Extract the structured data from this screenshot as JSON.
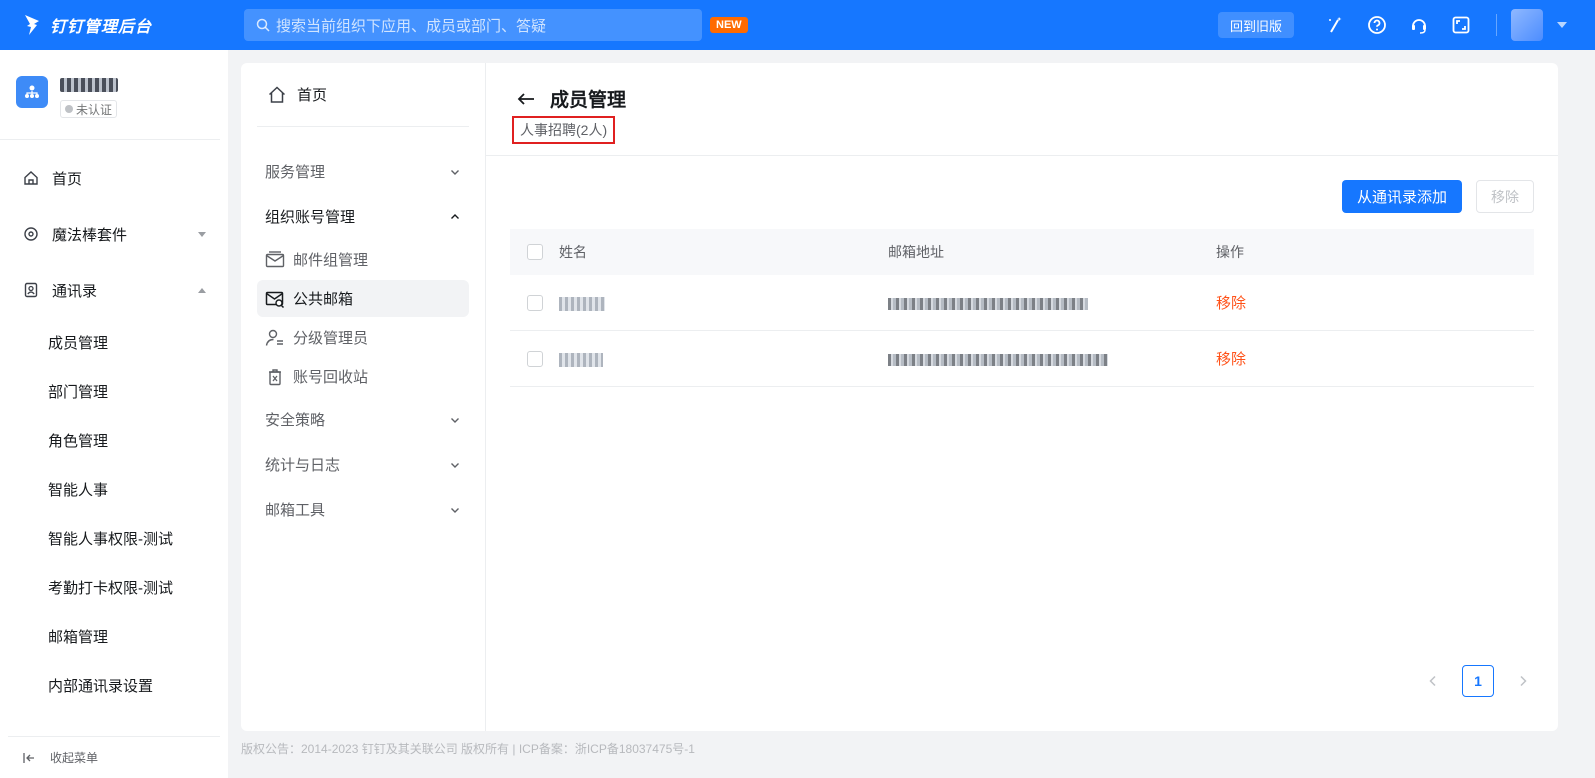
{
  "topbar": {
    "brand_title": "钉钉管理后台",
    "search_placeholder": "搜索当前组织下应用、成员或部门、答疑",
    "new_badge": "NEW",
    "old_version_label": "回到旧版"
  },
  "sidebar": {
    "org_cert": "未认证",
    "items": [
      {
        "label": "首页"
      },
      {
        "label": "魔法棒套件"
      },
      {
        "label": "通讯录"
      }
    ],
    "sub_items": [
      {
        "label": "成员管理"
      },
      {
        "label": "部门管理"
      },
      {
        "label": "角色管理"
      },
      {
        "label": "智能人事"
      },
      {
        "label": "智能人事权限-测试"
      },
      {
        "label": "考勤打卡权限-测试"
      },
      {
        "label": "邮箱管理"
      },
      {
        "label": "内部通讯录设置"
      }
    ],
    "collapse_label": "收起菜单"
  },
  "inner_nav": {
    "home": "首页",
    "groups": [
      {
        "label": "服务管理"
      },
      {
        "label": "组织账号管理"
      },
      {
        "label": "安全策略"
      },
      {
        "label": "统计与日志"
      },
      {
        "label": "邮箱工具"
      }
    ],
    "sub_items": [
      {
        "label": "邮件组管理"
      },
      {
        "label": "公共邮箱"
      },
      {
        "label": "分级管理员"
      },
      {
        "label": "账号回收站"
      }
    ]
  },
  "content": {
    "title": "成员管理",
    "group_label": "人事招聘(2人)",
    "add_button": "从通讯录添加",
    "remove_button": "移除",
    "table": {
      "headers": [
        "姓名",
        "邮箱地址",
        "操作"
      ],
      "rows": [
        {
          "action": "移除"
        },
        {
          "action": "移除"
        }
      ]
    },
    "pager": {
      "current": "1"
    }
  },
  "footer": "版权公告：2014-2023 钉钉及其关联公司 版权所有 | ICP备案：浙ICP备18037475号-1",
  "colors": {
    "brand": "#1677ff",
    "danger": "#ff5219",
    "highlight_border": "#e02020"
  }
}
